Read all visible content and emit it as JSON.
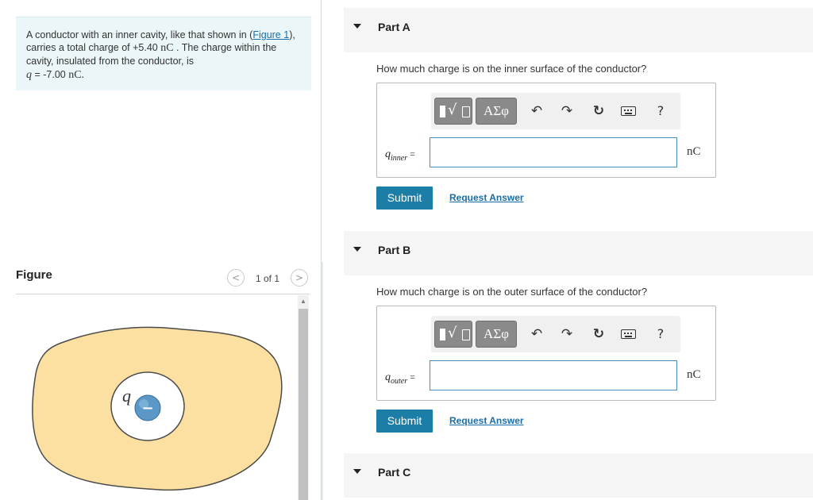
{
  "problem": {
    "text_intro": "A conductor with an inner cavity, like that shown in (",
    "figure_link": "Figure 1",
    "text_mid": "), carries a total charge of +5.40 ",
    "charge_unit": "nC",
    "text_end": " . The charge within the cavity, insulated from the conductor, is",
    "q_symbol": "q",
    "q_value": " = -7.00 ",
    "q_unit": "nC."
  },
  "figure": {
    "title": "Figure",
    "pager_prev": "<",
    "pager_next": ">",
    "pager_text": "1 of 1",
    "charge_label": "q",
    "charge_sign": "−",
    "colors": {
      "conductor_fill": "#fbe0a2",
      "conductor_stroke": "#4a4a4a",
      "charge_fill": "#5b97c7"
    }
  },
  "toolbar": {
    "greek_label": "ΑΣφ",
    "undo_icon": "undo-icon",
    "redo_icon": "redo-icon",
    "reset_icon": "reset-icon",
    "keyboard_icon": "keyboard-icon",
    "help_label": "?"
  },
  "parts": [
    {
      "label": "Part A",
      "question": "How much charge is on   the inner surface of the conductor?",
      "var_symbol": "q",
      "var_sub": "inner",
      "eq": "=",
      "input_value": "",
      "unit": "nC",
      "submit_label": "Submit",
      "request_label": "Request Answer"
    },
    {
      "label": "Part B",
      "question": "How much charge is on the outer surface of the conductor?",
      "var_symbol": "q",
      "var_sub": "outer",
      "eq": "=",
      "input_value": "",
      "unit": "nC",
      "submit_label": "Submit",
      "request_label": "Request Answer"
    },
    {
      "label": "Part C"
    }
  ],
  "colors": {
    "accent": "#1c7ea6",
    "link": "#1a6ea8",
    "problem_bg": "#eaf6f8"
  }
}
